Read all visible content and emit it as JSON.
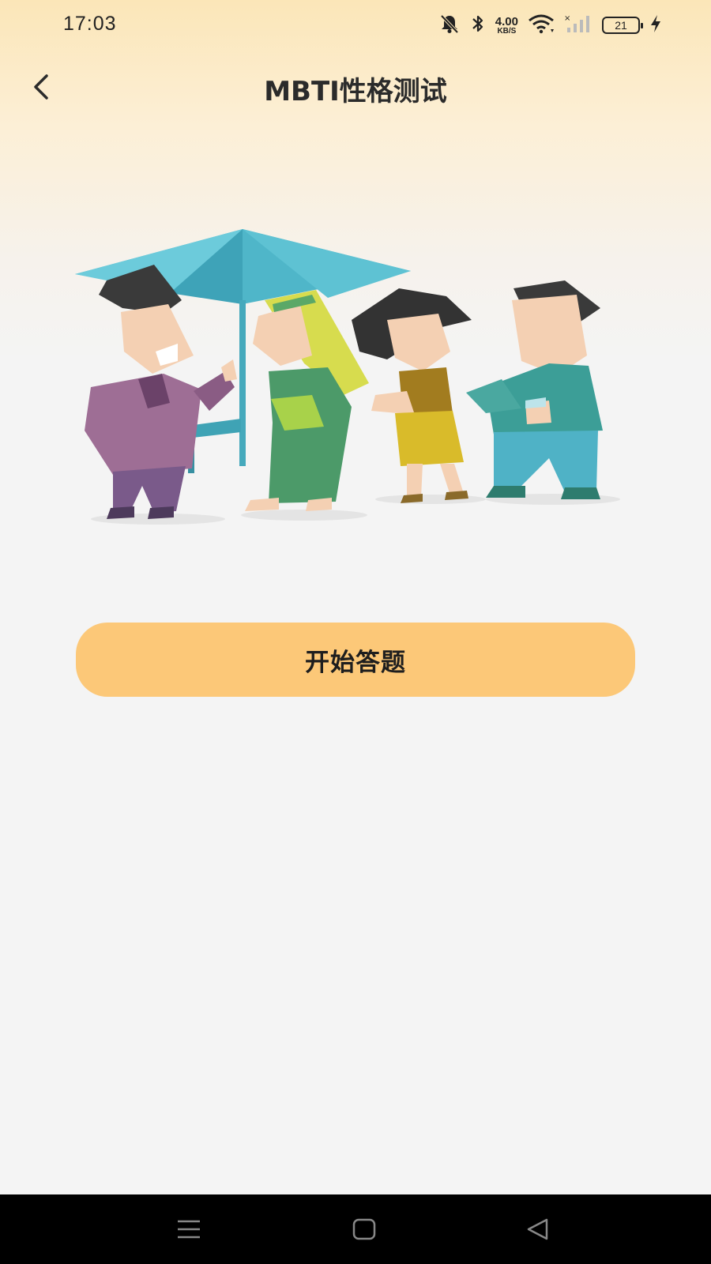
{
  "status_bar": {
    "time": "17:03",
    "net_speed_value": "4.00",
    "net_speed_unit": "KB/S",
    "battery_level": "21",
    "icons": [
      "bell-off-icon",
      "bluetooth-icon",
      "wifi-icon",
      "cellular-signal-icon",
      "battery-icon",
      "charging-icon"
    ]
  },
  "header": {
    "title": "MBTI性格测试",
    "back_icon": "chevron-left-icon"
  },
  "illustration": {
    "icon": "people-under-umbrella-illustration"
  },
  "main": {
    "start_button_label": "开始答题"
  },
  "navigation_bar": {
    "icons": [
      "menu-icon",
      "home-icon",
      "back-triangle-icon"
    ]
  },
  "colors": {
    "accent": "#fcc878",
    "header_gradient_top": "#fbe6b8",
    "background": "#f4f4f4",
    "nav_bar": "#000000"
  }
}
